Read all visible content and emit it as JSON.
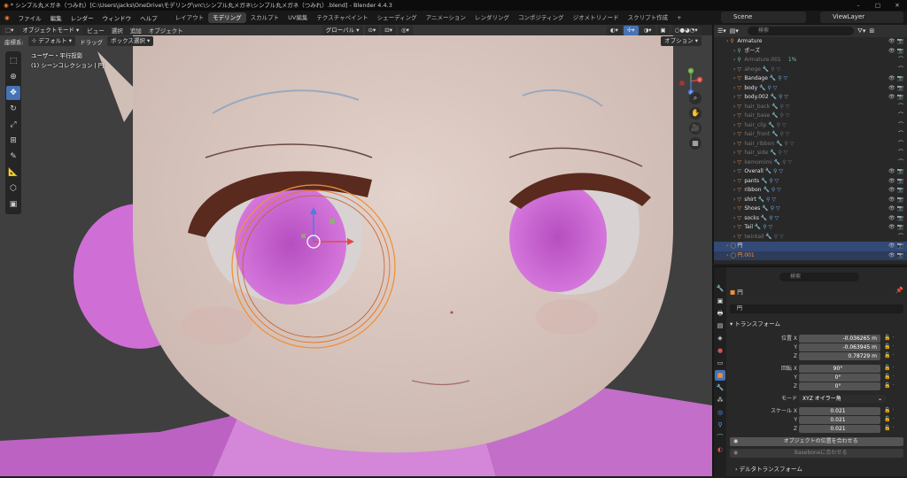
{
  "window": {
    "title": "* シンプル丸メガネ（つみれ）[C:\\Users\\jacks\\OneDrive\\モデリング\\vrc\\シンプル丸メガネ\\シンプル丸メガネ（つみれ）.blend] - Blender 4.4.3"
  },
  "menu": {
    "items": [
      "ファイル",
      "編集",
      "レンダー",
      "ウィンドウ",
      "ヘルプ"
    ],
    "workspaces": [
      "レイアウト",
      "モデリング",
      "スカルプト",
      "UV編集",
      "テクスチャペイント",
      "シェーディング",
      "アニメーション",
      "レンダリング",
      "コンポジティング",
      "ジオメトリノード",
      "スクリプト作成"
    ],
    "active_workspace_index": 1,
    "add_tab": "+",
    "scene": "Scene",
    "view_layer": "ViewLayer"
  },
  "viewport": {
    "mode": "オブジェクトモード",
    "menus": [
      "ビュー",
      "選択",
      "追加",
      "オブジェクト"
    ],
    "orientation": "グローバル",
    "coord_label": "座標系:",
    "coord_value": "デフォルト",
    "drag_label": "ドラッグ",
    "select_mode": "ボックス選択",
    "options": "オプション",
    "overlay_line1": "ユーザー・平行投影",
    "overlay_line2": "(1) シーンコレクション | 円",
    "gizmo_axes": [
      "X",
      "Y",
      "Z"
    ]
  },
  "outliner": {
    "search_placeholder": "検索",
    "rows": [
      {
        "name": "Armature",
        "type": "armature",
        "state": "normal",
        "indent": 0
      },
      {
        "name": "ポーズ",
        "type": "pose",
        "state": "normal",
        "indent": 1
      },
      {
        "name": "Armature.001",
        "type": "data",
        "state": "dim",
        "indent": 1,
        "extra": "1%"
      },
      {
        "name": "ahoge",
        "type": "mesh",
        "state": "dim",
        "indent": 1
      },
      {
        "name": "Bandage",
        "type": "mesh",
        "state": "normal",
        "indent": 1
      },
      {
        "name": "body",
        "type": "mesh",
        "state": "normal",
        "indent": 1
      },
      {
        "name": "body.002",
        "type": "mesh",
        "state": "normal",
        "indent": 1
      },
      {
        "name": "hair_back",
        "type": "mesh",
        "state": "dim",
        "indent": 1
      },
      {
        "name": "hair_base",
        "type": "mesh",
        "state": "dim",
        "indent": 1
      },
      {
        "name": "hair_clip",
        "type": "mesh",
        "state": "dim",
        "indent": 1
      },
      {
        "name": "hair_front",
        "type": "mesh",
        "state": "dim",
        "indent": 1
      },
      {
        "name": "hair_ribbon",
        "type": "mesh",
        "state": "dim",
        "indent": 1
      },
      {
        "name": "hair_side",
        "type": "mesh",
        "state": "dim",
        "indent": 1
      },
      {
        "name": "kemomimi",
        "type": "mesh",
        "state": "dim",
        "indent": 1
      },
      {
        "name": "Overall",
        "type": "mesh",
        "state": "normal",
        "indent": 1
      },
      {
        "name": "pants",
        "type": "mesh",
        "state": "normal",
        "indent": 1
      },
      {
        "name": "ribbon",
        "type": "mesh",
        "state": "normal",
        "indent": 1
      },
      {
        "name": "shirt",
        "type": "mesh",
        "state": "normal",
        "indent": 1
      },
      {
        "name": "Shoes",
        "type": "mesh",
        "state": "normal",
        "indent": 1
      },
      {
        "name": "socks",
        "type": "mesh",
        "state": "normal",
        "indent": 1
      },
      {
        "name": "Tail",
        "type": "mesh",
        "state": "normal",
        "indent": 1
      },
      {
        "name": "twintail",
        "type": "mesh",
        "state": "dim",
        "indent": 1
      },
      {
        "name": "円",
        "type": "curve",
        "state": "active",
        "indent": 0
      },
      {
        "name": "円.001",
        "type": "curve",
        "state": "selected",
        "indent": 0
      }
    ]
  },
  "properties": {
    "search_placeholder": "検索",
    "object_name": "円",
    "object_name_field": "円",
    "section_transform": "トランスフォーム",
    "location_label": "位置 X",
    "location": [
      "-0.036265 m",
      "-0.063945 m",
      "0.78729 m"
    ],
    "rotation_label": "回転 X",
    "rotation": [
      "90°",
      "0°",
      "0°"
    ],
    "mode_label": "モード",
    "mode_value": "XYZ オイラー角",
    "scale_label": "スケール X",
    "scale": [
      "0.021",
      "0.021",
      "0.021"
    ],
    "y_label": "Y",
    "z_label": "Z",
    "btn_match_location": "オブジェクトの位置を合わせる",
    "btn_match_bone": "Baseboneに合わせる",
    "section_delta": "デルタトランスフォーム"
  },
  "colors": {
    "accent": "#4772b3",
    "skin": "#dcc8c0",
    "pink": "#c85ad2",
    "eye_pink": "#c762cf",
    "selected_orange": "#f0913a"
  }
}
